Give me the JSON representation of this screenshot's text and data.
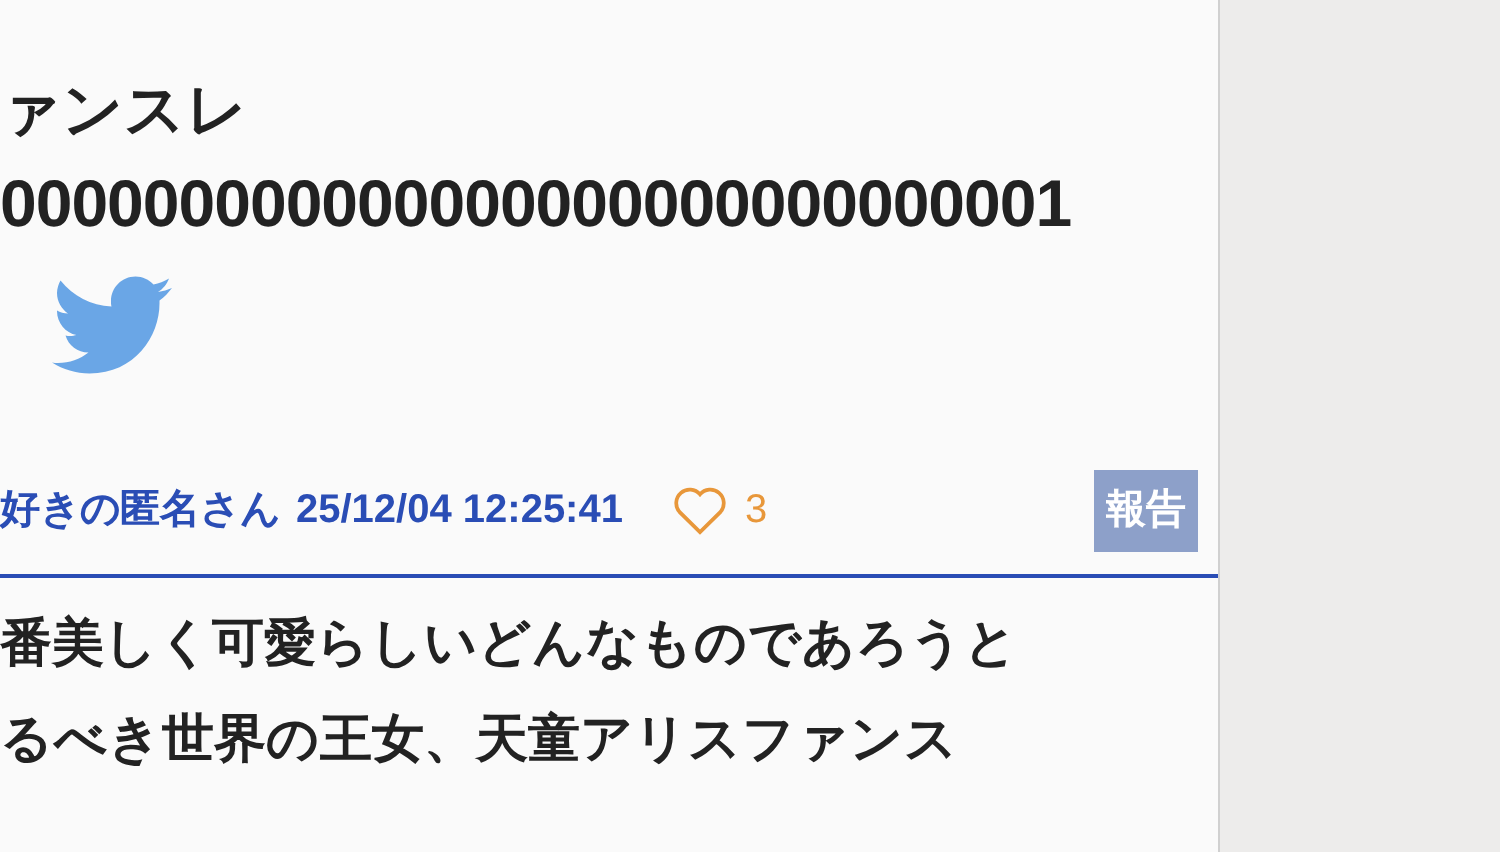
{
  "thread": {
    "title_lines": [
      "ァンスレ",
      "000000000000000000000000000001"
    ]
  },
  "post": {
    "author": "好きの匿名さん",
    "timestamp": "25/12/04 12:25:41",
    "likes": "3",
    "report_button": "報告",
    "body_lines": [
      "番美しく可愛らしいどんなものであろうと",
      "るべき世界の王女、天童アリスファンス"
    ]
  }
}
